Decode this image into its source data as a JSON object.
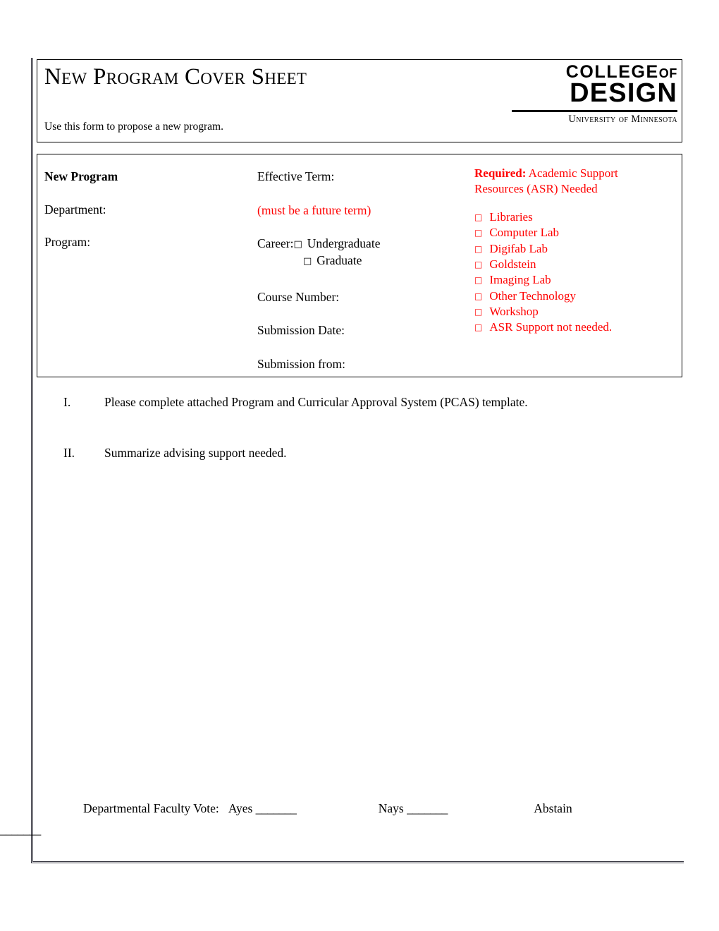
{
  "header": {
    "title": "New Program Cover Sheet",
    "subtitle": "Use this form to propose a new program.",
    "logo": {
      "line1_main": "COLLEGE",
      "line1_of": "OF",
      "line2": "DESIGN",
      "line3": "University of Minnesota"
    }
  },
  "info_box": {
    "left_column": {
      "heading": "New Program",
      "department_label": "Department:",
      "program_label": "Program:"
    },
    "middle_column": {
      "effective_term_label": "Effective Term:",
      "effective_term_note": "(must be a future term)",
      "career_label": "Career:",
      "career_options": [
        "Undergraduate",
        "Graduate"
      ],
      "course_number_label": "Course Number:",
      "submission_date_label": "Submission Date:",
      "submission_from_label": "Submission from:"
    },
    "right_column": {
      "heading_bold": "Required:",
      "heading_rest": " Academic Support",
      "heading_line2": "Resources (ASR) Needed",
      "checkbox_glyph": "□",
      "items": [
        "Libraries",
        "Computer Lab",
        "Digifab Lab",
        "Goldstein",
        "Imaging Lab",
        "Other Technology",
        "Workshop",
        "ASR Support not needed."
      ],
      "color": "#ff0000"
    }
  },
  "instructions": [
    {
      "num": "I.",
      "text": "Please complete attached Program and Curricular Approval System (PCAS) template."
    },
    {
      "num": "II.",
      "text": "Summarize advising support needed."
    }
  ],
  "faculty_vote": {
    "label": "Departmental Faculty Vote:",
    "ayes_label": "Ayes",
    "ayes_blank": "_______",
    "nays_label": "Nays",
    "nays_blank": "_______",
    "abstain_label": "Abstain",
    "abstain_blank": "_______"
  },
  "checkbox_glyph": "□"
}
